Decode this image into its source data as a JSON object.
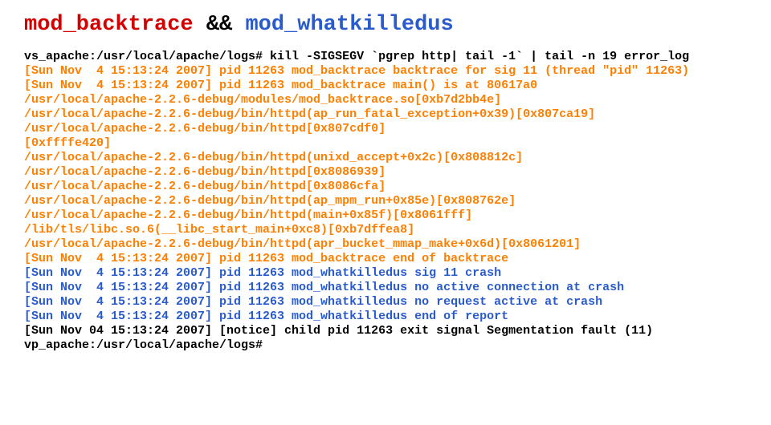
{
  "title": {
    "part1": "mod_backtrace",
    "conn": " && ",
    "part2": "mod_whatkilledus"
  },
  "lines": [
    {
      "color": "black",
      "text": "vs_apache:/usr/local/apache/logs# kill -SIGSEGV `pgrep http| tail -1` | tail -n 19 error_log"
    },
    {
      "color": "orange",
      "text": "[Sun Nov  4 15:13:24 2007] pid 11263 mod_backtrace backtrace for sig 11 (thread \"pid\" 11263)"
    },
    {
      "color": "orange",
      "text": "[Sun Nov  4 15:13:24 2007] pid 11263 mod_backtrace main() is at 80617a0"
    },
    {
      "color": "orange",
      "text": "/usr/local/apache-2.2.6-debug/modules/mod_backtrace.so[0xb7d2bb4e]"
    },
    {
      "color": "orange",
      "text": "/usr/local/apache-2.2.6-debug/bin/httpd(ap_run_fatal_exception+0x39)[0x807ca19]"
    },
    {
      "color": "orange",
      "text": "/usr/local/apache-2.2.6-debug/bin/httpd[0x807cdf0]"
    },
    {
      "color": "orange",
      "text": "[0xffffe420]"
    },
    {
      "color": "orange",
      "text": "/usr/local/apache-2.2.6-debug/bin/httpd(unixd_accept+0x2c)[0x808812c]"
    },
    {
      "color": "orange",
      "text": "/usr/local/apache-2.2.6-debug/bin/httpd[0x8086939]"
    },
    {
      "color": "orange",
      "text": "/usr/local/apache-2.2.6-debug/bin/httpd[0x8086cfa]"
    },
    {
      "color": "orange",
      "text": "/usr/local/apache-2.2.6-debug/bin/httpd(ap_mpm_run+0x85e)[0x808762e]"
    },
    {
      "color": "orange",
      "text": "/usr/local/apache-2.2.6-debug/bin/httpd(main+0x85f)[0x8061fff]"
    },
    {
      "color": "orange",
      "text": "/lib/tls/libc.so.6(__libc_start_main+0xc8)[0xb7dffea8]"
    },
    {
      "color": "orange",
      "text": "/usr/local/apache-2.2.6-debug/bin/httpd(apr_bucket_mmap_make+0x6d)[0x8061201]"
    },
    {
      "color": "orange",
      "text": "[Sun Nov  4 15:13:24 2007] pid 11263 mod_backtrace end of backtrace"
    },
    {
      "color": "blue",
      "text": "[Sun Nov  4 15:13:24 2007] pid 11263 mod_whatkilledus sig 11 crash"
    },
    {
      "color": "blue",
      "text": "[Sun Nov  4 15:13:24 2007] pid 11263 mod_whatkilledus no active connection at crash"
    },
    {
      "color": "blue",
      "text": "[Sun Nov  4 15:13:24 2007] pid 11263 mod_whatkilledus no request active at crash"
    },
    {
      "color": "blue",
      "text": "[Sun Nov  4 15:13:24 2007] pid 11263 mod_whatkilledus end of report"
    },
    {
      "color": "black",
      "text": "[Sun Nov 04 15:13:24 2007] [notice] child pid 11263 exit signal Segmentation fault (11)"
    },
    {
      "color": "black",
      "text": "vp_apache:/usr/local/apache/logs#"
    }
  ]
}
